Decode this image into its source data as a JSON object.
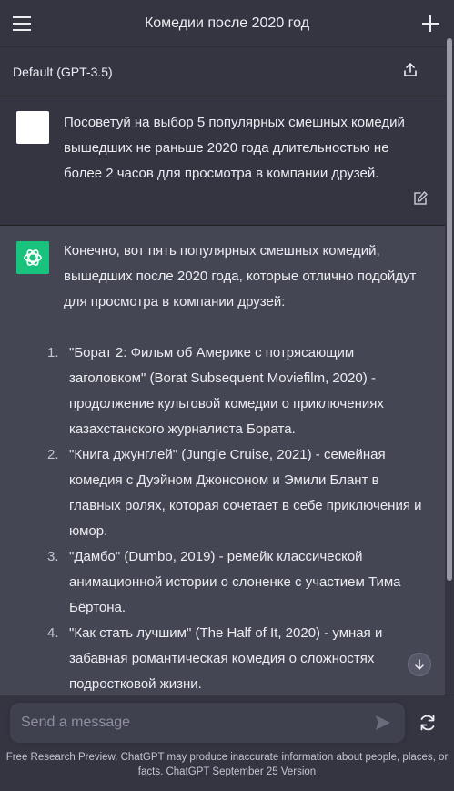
{
  "header": {
    "title": "Комедии после 2020 год"
  },
  "model_bar": {
    "model_label": "Default (GPT-3.5)"
  },
  "user_message": {
    "text": "Посоветуй на выбор 5 популярных смешных комедий вышедших не раньше 2020 года длительностью не более 2 часов для просмотра в компании друзей."
  },
  "assistant_message": {
    "intro": "Конечно, вот пять популярных смешных комедий, вышедших после 2020 года, которые отлично подойдут для просмотра в компании друзей:",
    "items": [
      {
        "num": "1.",
        "text": "\"Борат 2: Фильм об Америке с потрясающим заголовком\" (Borat Subsequent Moviefilm, 2020) - продолжение культовой комедии о приключениях казахстанского журналиста Бората."
      },
      {
        "num": "2.",
        "text": "\"Книга джунглей\" (Jungle Cruise, 2021) - семейная комедия с Дуэйном Джонсоном и Эмили Блант в главных ролях, которая сочетает в себе приключения и юмор."
      },
      {
        "num": "3.",
        "text": "\"Дамбо\" (Dumbo, 2019) - ремейк классической анимационной истории о слоненке с участием Тима Бёртона."
      },
      {
        "num": "4.",
        "text": "\"Как стать лучшим\" (The Half of It, 2020) - умная и забавная романтическая комедия о сложностях подростковой жизни."
      }
    ]
  },
  "composer": {
    "placeholder": "Send a message"
  },
  "footer": {
    "text": "Free Research Preview. ChatGPT may produce inaccurate information about people, places, or facts.",
    "link": "ChatGPT September 25 Version"
  },
  "colors": {
    "background": "#343541",
    "assistant_background": "#444654",
    "assistant_avatar": "#19c37d",
    "input_background": "#40414f"
  },
  "icons": [
    "menu-icon",
    "plus-icon",
    "share-icon",
    "edit-icon",
    "openai-logo-icon",
    "arrow-down-icon",
    "send-icon",
    "refresh-icon"
  ]
}
